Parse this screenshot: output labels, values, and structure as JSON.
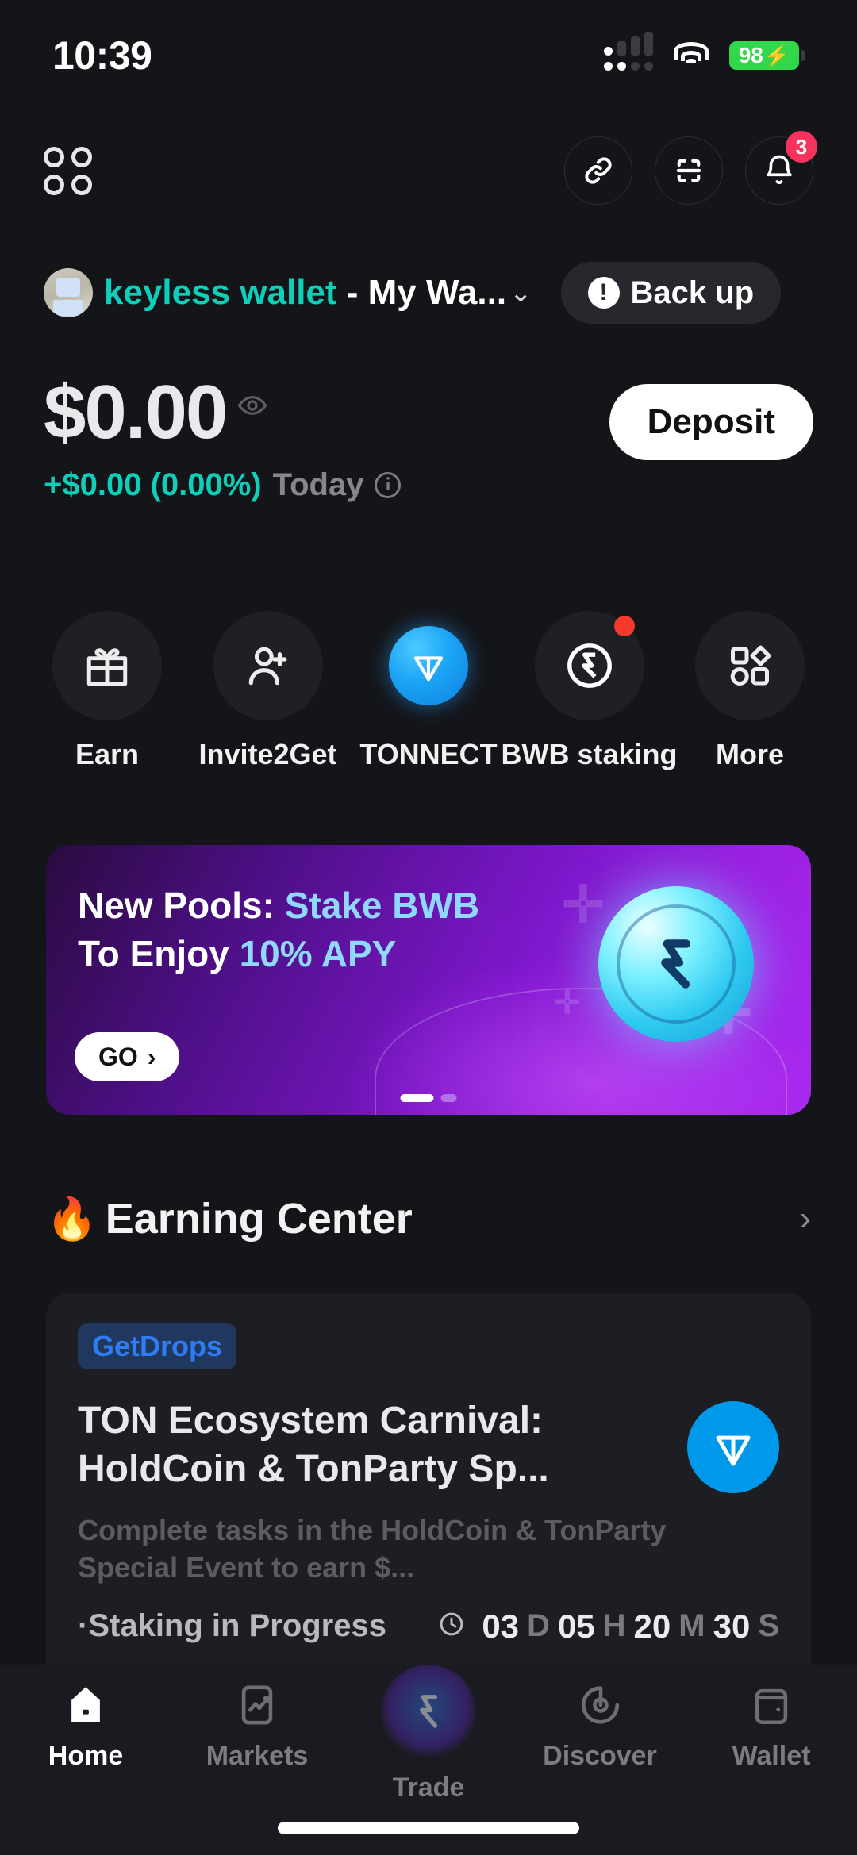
{
  "status_bar": {
    "time": "10:39",
    "battery_percent": "98",
    "charging_glyph": "⚡",
    "signal_icon": "signal-bars-icon",
    "wifi_icon": "wifi-icon"
  },
  "top_nav": {
    "apps_icon": "apps-grid-icon",
    "link_icon": "link-icon",
    "scan_icon": "scan-icon",
    "bell_icon": "bell-icon",
    "bell_badge": "3"
  },
  "wallet": {
    "avatar_icon": "wallet-avatar",
    "name_highlight": "keyless wallet",
    "name_rest": " - My Wa...",
    "chevron": "⌄",
    "backup_label": "Back up",
    "backup_icon": "warning-icon"
  },
  "balance": {
    "amount": "$0.00",
    "eye_icon": "eye-icon",
    "change": "+$0.00 (0.00%)",
    "period": "Today",
    "info_icon": "info-icon",
    "deposit_label": "Deposit",
    "accent_color": "#0ed0ba"
  },
  "quick_actions": [
    {
      "label": "Earn",
      "icon": "gift-icon",
      "badge": false
    },
    {
      "label": "Invite2Get",
      "icon": "person-add-icon",
      "badge": false
    },
    {
      "label": "TONNECT",
      "icon": "ton-coin-icon",
      "badge": false
    },
    {
      "label": "BWB staking",
      "icon": "bwb-logo-icon",
      "badge": true
    },
    {
      "label": "More",
      "icon": "shapes-grid-icon",
      "badge": false
    }
  ],
  "banner": {
    "line1_plain": "New Pools: ",
    "line1_highlight": "Stake BWB",
    "line2_plain": "To Enjoy ",
    "line2_highlight": "10% APY",
    "cta_label": "GO",
    "cta_chevron": "›",
    "coin_icon": "bwb-coin-icon",
    "highlight_color": "#8fd8ff",
    "pages": 2,
    "active_page": 1
  },
  "earning_center": {
    "emoji": "🔥",
    "title": "Earning Center",
    "chevron": "›",
    "card": {
      "tag": "GetDrops",
      "title": "TON Ecosystem Carnival: HoldCoin & TonParty Sp...",
      "description": "Complete tasks in the HoldCoin & TonParty Special Event to earn $...",
      "status": "·Staking in Progress",
      "clock_icon": "clock-icon",
      "logo_icon": "ton-logo-icon",
      "countdown": [
        {
          "value": "03",
          "unit": "D"
        },
        {
          "value": "05",
          "unit": "H"
        },
        {
          "value": "20",
          "unit": "M"
        },
        {
          "value": "30",
          "unit": "S"
        }
      ]
    }
  },
  "tabbar": {
    "items": [
      {
        "label": "Home",
        "icon": "home-icon",
        "active": true
      },
      {
        "label": "Markets",
        "icon": "markets-chart-icon",
        "active": false
      },
      {
        "label": "Trade",
        "icon": "trade-logo-icon",
        "active": false
      },
      {
        "label": "Discover",
        "icon": "discover-compass-icon",
        "active": false
      },
      {
        "label": "Wallet",
        "icon": "wallet-icon",
        "active": false
      }
    ]
  }
}
